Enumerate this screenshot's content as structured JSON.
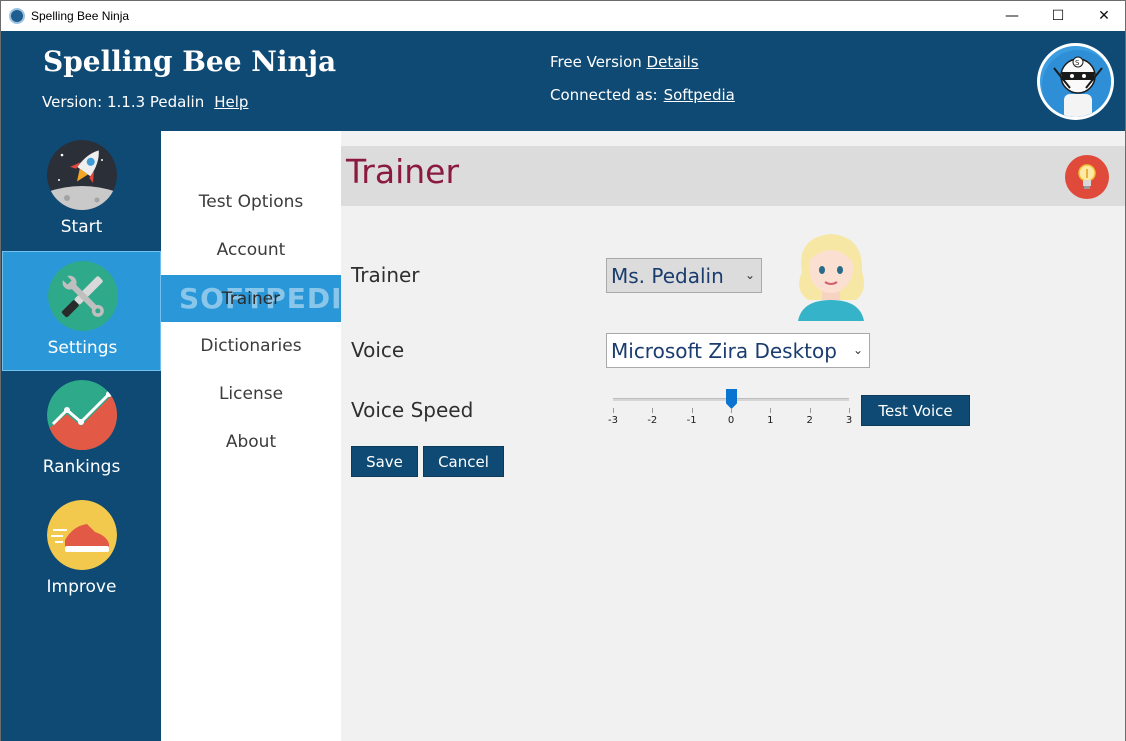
{
  "window": {
    "title": "Spelling Bee Ninja",
    "minimize_glyph": "—",
    "maximize_glyph": "☐",
    "close_glyph": "✕"
  },
  "header": {
    "brand": "Spelling Bee Ninja",
    "version_label": "Version: 1.1.3 Pedalin",
    "help_link": "Help",
    "plan_label": "Free Version",
    "details_link": "Details",
    "connected_label": "Connected as:",
    "user_link": "Softpedia"
  },
  "nav": {
    "items": [
      {
        "label": "Start",
        "icon": "rocket-icon"
      },
      {
        "label": "Settings",
        "icon": "tools-icon"
      },
      {
        "label": "Rankings",
        "icon": "chart-icon"
      },
      {
        "label": "Improve",
        "icon": "sneaker-icon"
      }
    ],
    "active": "Settings"
  },
  "subnav": {
    "items": [
      "Test Options",
      "Account",
      "Trainer",
      "Dictionaries",
      "License",
      "About"
    ],
    "active": "Trainer",
    "watermark": "SOFTPEDIA"
  },
  "content": {
    "title": "Trainer",
    "trainer_label": "Trainer",
    "trainer_value": "Ms. Pedalin",
    "voice_label": "Voice",
    "voice_value": "Microsoft Zira Desktop",
    "speed_label": "Voice Speed",
    "speed_value": 0,
    "speed_ticks": [
      "-3",
      "-2",
      "-1",
      "0",
      "1",
      "2",
      "3"
    ],
    "test_voice": "Test Voice",
    "save": "Save",
    "cancel": "Cancel"
  },
  "colors": {
    "header_bg": "#0e4a74",
    "active_bg": "#2a98d8",
    "title_color": "#8b1a3f",
    "tip_bg": "#e04a3b"
  }
}
